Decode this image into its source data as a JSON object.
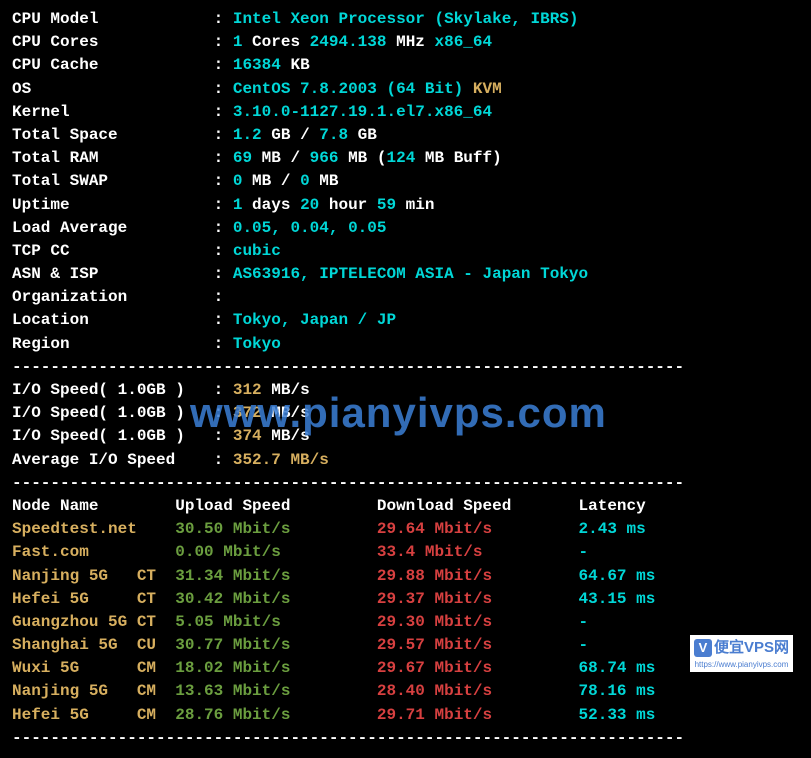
{
  "sysinfo": [
    {
      "label": "CPU Model",
      "pad": 14,
      "segments": [
        {
          "text": "Intel Xeon Processor (Skylake, IBRS)",
          "cls": "cyan"
        }
      ]
    },
    {
      "label": "CPU Cores",
      "pad": 14,
      "segments": [
        {
          "text": "1",
          "cls": "cyan"
        },
        {
          "text": " Cores ",
          "cls": "white"
        },
        {
          "text": "2494.138",
          "cls": "cyan"
        },
        {
          "text": " MHz ",
          "cls": "white"
        },
        {
          "text": "x86_64",
          "cls": "cyan"
        }
      ]
    },
    {
      "label": "CPU Cache",
      "pad": 14,
      "segments": [
        {
          "text": "16384",
          "cls": "cyan"
        },
        {
          "text": " KB",
          "cls": "white"
        }
      ]
    },
    {
      "label": "OS",
      "pad": 14,
      "segments": [
        {
          "text": "CentOS 7.8.2003 (64 Bit)",
          "cls": "cyan"
        },
        {
          "text": " KVM",
          "cls": "yellow"
        }
      ]
    },
    {
      "label": "Kernel",
      "pad": 14,
      "segments": [
        {
          "text": "3.10.0-1127.19.1.el7.x86_64",
          "cls": "cyan"
        }
      ]
    },
    {
      "label": "Total Space",
      "pad": 14,
      "segments": [
        {
          "text": "1.2",
          "cls": "cyan"
        },
        {
          "text": " GB / ",
          "cls": "white"
        },
        {
          "text": "7.8",
          "cls": "cyan"
        },
        {
          "text": " GB",
          "cls": "white"
        }
      ]
    },
    {
      "label": "Total RAM",
      "pad": 14,
      "segments": [
        {
          "text": "69",
          "cls": "cyan"
        },
        {
          "text": " MB / ",
          "cls": "white"
        },
        {
          "text": "966",
          "cls": "cyan"
        },
        {
          "text": " MB (",
          "cls": "white"
        },
        {
          "text": "124",
          "cls": "cyan"
        },
        {
          "text": " MB Buff)",
          "cls": "white"
        }
      ]
    },
    {
      "label": "Total SWAP",
      "pad": 14,
      "segments": [
        {
          "text": "0",
          "cls": "cyan"
        },
        {
          "text": " MB / ",
          "cls": "white"
        },
        {
          "text": "0",
          "cls": "cyan"
        },
        {
          "text": " MB",
          "cls": "white"
        }
      ]
    },
    {
      "label": "Uptime",
      "pad": 14,
      "segments": [
        {
          "text": "1",
          "cls": "cyan"
        },
        {
          "text": " days ",
          "cls": "white"
        },
        {
          "text": "20",
          "cls": "cyan"
        },
        {
          "text": " hour ",
          "cls": "white"
        },
        {
          "text": "59",
          "cls": "cyan"
        },
        {
          "text": " min",
          "cls": "white"
        }
      ]
    },
    {
      "label": "Load Average",
      "pad": 14,
      "segments": [
        {
          "text": "0.05, 0.04, 0.05",
          "cls": "cyan"
        }
      ]
    },
    {
      "label": "TCP CC",
      "pad": 14,
      "segments": [
        {
          "text": "cubic",
          "cls": "cyan"
        }
      ]
    },
    {
      "label": "ASN & ISP",
      "pad": 14,
      "segments": [
        {
          "text": "AS63916, IPTELECOM ASIA - Japan Tokyo",
          "cls": "cyan"
        }
      ]
    },
    {
      "label": "Organization",
      "pad": 14,
      "segments": []
    },
    {
      "label": "Location",
      "pad": 14,
      "segments": [
        {
          "text": "Tokyo, Japan / JP",
          "cls": "cyan"
        }
      ]
    },
    {
      "label": "Region",
      "pad": 14,
      "segments": [
        {
          "text": "Tokyo",
          "cls": "cyan"
        }
      ]
    }
  ],
  "iospeed": [
    {
      "label": "I/O Speed( 1.0GB )",
      "value": "312",
      "unit": " MB/s"
    },
    {
      "label": "I/O Speed( 1.0GB )",
      "value": "372",
      "unit": " MB/s"
    },
    {
      "label": "I/O Speed( 1.0GB )",
      "value": "374",
      "unit": " MB/s"
    }
  ],
  "ioavg": {
    "label": "Average I/O Speed",
    "value": "352.7 MB/s"
  },
  "speedtest": {
    "headers": {
      "node": "Node Name",
      "upload": "Upload Speed",
      "download": "Download Speed",
      "latency": "Latency"
    },
    "rows": [
      {
        "node": "Speedtest.net",
        "upload": "30.50 Mbit/s",
        "download": "29.64 Mbit/s",
        "latency": "2.43 ms"
      },
      {
        "node": "Fast.com",
        "upload": "0.00 Mbit/s",
        "download": "33.4 Mbit/s",
        "latency": "-"
      },
      {
        "node": "Nanjing 5G   CT",
        "upload": "31.34 Mbit/s",
        "download": "29.88 Mbit/s",
        "latency": "64.67 ms"
      },
      {
        "node": "Hefei 5G     CT",
        "upload": "30.42 Mbit/s",
        "download": "29.37 Mbit/s",
        "latency": "43.15 ms"
      },
      {
        "node": "Guangzhou 5G CT",
        "upload": "5.05 Mbit/s",
        "download": "29.30 Mbit/s",
        "latency": "-"
      },
      {
        "node": "Shanghai 5G  CU",
        "upload": "30.77 Mbit/s",
        "download": "29.57 Mbit/s",
        "latency": "-"
      },
      {
        "node": "Wuxi 5G      CM",
        "upload": "18.02 Mbit/s",
        "download": "29.67 Mbit/s",
        "latency": "68.74 ms"
      },
      {
        "node": "Nanjing 5G   CM",
        "upload": "13.63 Mbit/s",
        "download": "28.40 Mbit/s",
        "latency": "78.16 ms"
      },
      {
        "node": "Hefei 5G     CM",
        "upload": "28.76 Mbit/s",
        "download": "29.71 Mbit/s",
        "latency": "52.33 ms"
      }
    ]
  },
  "watermark": {
    "url": "www.pianyivps.com",
    "badge": "V",
    "label": "便宜VPS网",
    "small": "https://www.pianyivps.com"
  },
  "dashes": "----------------------------------------------------------------------"
}
